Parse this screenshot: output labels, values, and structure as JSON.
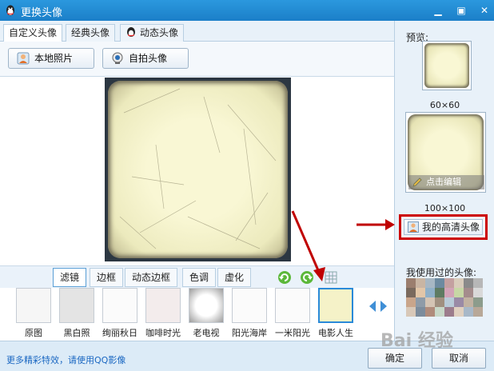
{
  "window": {
    "title": "更换头像",
    "icon": "qq-penguin-icon",
    "controls": [
      "minimize-icon",
      "maximize-icon",
      "close-icon"
    ]
  },
  "tabs": [
    {
      "label": "自定义头像",
      "active": true
    },
    {
      "label": "经典头像",
      "active": false
    },
    {
      "label": "动态头像",
      "active": false,
      "icon": "penguin-icon"
    }
  ],
  "toolbar": {
    "local_photo": "本地照片",
    "webcam": "自拍头像"
  },
  "filter_tabs": [
    {
      "label": "滤镜",
      "active": true
    },
    {
      "label": "边框",
      "active": false
    },
    {
      "label": "动态边框",
      "active": false
    },
    {
      "label": "色调",
      "active": false
    },
    {
      "label": "虚化",
      "active": false
    }
  ],
  "filters": [
    {
      "label": "原图",
      "tone": "#f6f6f6"
    },
    {
      "label": "黑白照",
      "tone": "#e4e4e4"
    },
    {
      "label": "绚丽秋日",
      "tone": "#fbfbfb"
    },
    {
      "label": "咖啡时光",
      "tone": "#f3ecec"
    },
    {
      "label": "老电视",
      "tone": "#d9d9d9"
    },
    {
      "label": "阳光海岸",
      "tone": "#fbfbfb"
    },
    {
      "label": "一米阳光",
      "tone": "#fbfbfb"
    },
    {
      "label": "电影人生",
      "tone": "#f5f2c8",
      "selected": true
    }
  ],
  "footer": {
    "link": "更多精彩特效，请使用QQ影像",
    "ok": "确定",
    "cancel": "取消"
  },
  "side": {
    "preview_label": "预览:",
    "size_small": "60×60",
    "size_big": "100×100",
    "edit_label": "点击编辑",
    "hd_avatar": "我的高清头像",
    "used_label": "我使用过的头像:"
  },
  "watermark": "Bai 经验",
  "colors": {
    "title_bar": "#1b7fc8",
    "accent": "#2a8ad8",
    "annotation_red": "#c00000",
    "link": "#1a67c2"
  }
}
